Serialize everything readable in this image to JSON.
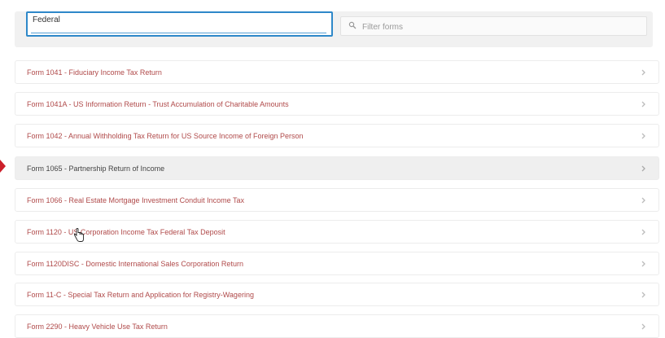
{
  "search": {
    "jurisdiction_value": "Federal",
    "filter_placeholder": "Filter forms"
  },
  "forms": [
    {
      "label": "Form 1041 - Fiduciary Income Tax Return"
    },
    {
      "label": "Form 1041A - US Information Return - Trust Accumulation of Charitable Amounts"
    },
    {
      "label": "Form 1042 - Annual Withholding Tax Return for US Source Income of Foreign Person"
    },
    {
      "label": "Form 1065 - Partnership Return of Income",
      "highlighted": true
    },
    {
      "label": "Form 1066 - Real Estate Mortgage Investment Conduit Income Tax"
    },
    {
      "label": "Form 1120 - US Corporation Income Tax Federal Tax Deposit"
    },
    {
      "label": "Form 1120DISC - Domestic International Sales Corporation Return"
    },
    {
      "label": "Form 11-C - Special Tax Return and Application for Registry-Wagering"
    },
    {
      "label": "Form 2290 - Heavy Vehicle Use Tax Return"
    }
  ],
  "icons": {
    "filter": "search-icon",
    "row": "chevron-right-icon",
    "cursor": "hand-pointer-icon"
  },
  "colors": {
    "accent": "#2e88c9",
    "form_label": "#b04a4a",
    "highlight_row": "#efefef",
    "warning": "#cc1f2a"
  }
}
